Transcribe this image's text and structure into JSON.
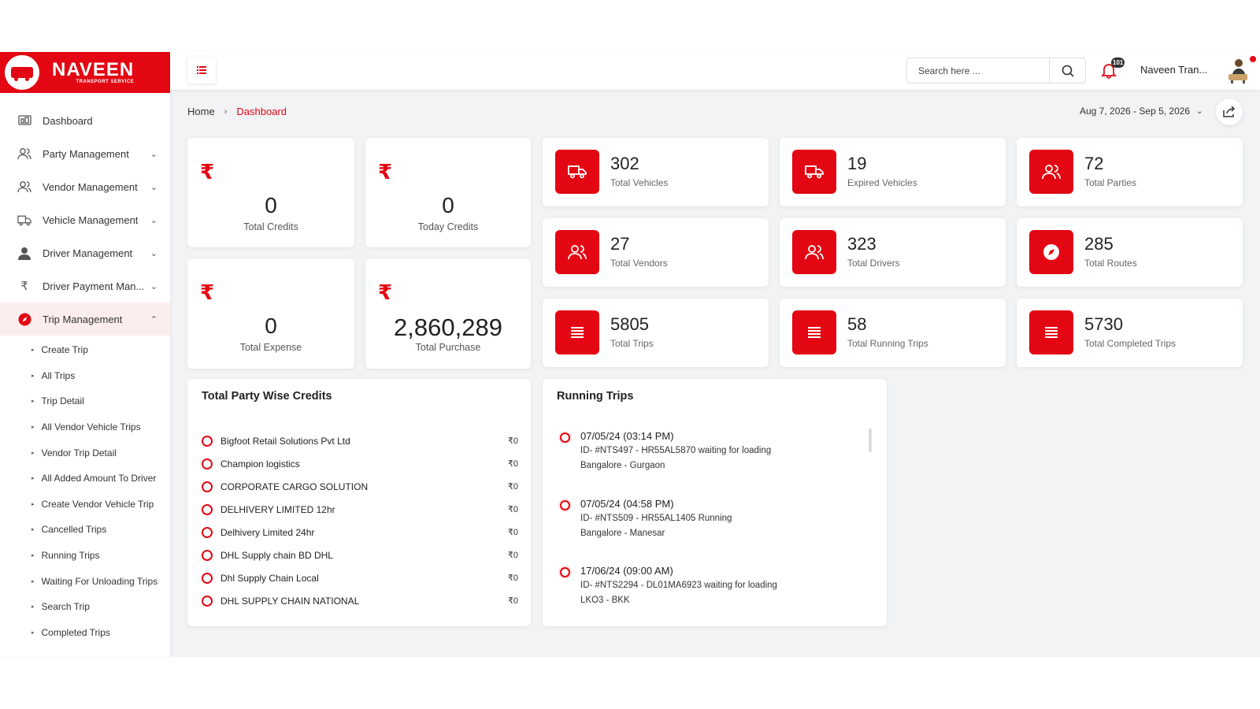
{
  "brand": {
    "name": "NAVEEN",
    "tagline": "TRANSPORT SERVICE",
    "color": "#e30613"
  },
  "topbar": {
    "search_placeholder": "Search here ...",
    "notification_count": "101",
    "user_name": "Naveen Tran..."
  },
  "breadcrumb": {
    "home": "Home",
    "separator": "›",
    "current": "Dashboard"
  },
  "date_range": "Aug 7, 2026 - Sep 5, 2026",
  "sidebar": {
    "items": [
      {
        "label": "Dashboard",
        "icon": "dashboard-icon"
      },
      {
        "label": "Party Management",
        "icon": "users-icon"
      },
      {
        "label": "Vendor Management",
        "icon": "users-icon"
      },
      {
        "label": "Vehicle Management",
        "icon": "truck-icon"
      },
      {
        "label": "Driver Management",
        "icon": "person-icon"
      },
      {
        "label": "Driver Payment Man...",
        "icon": "rupee-icon"
      },
      {
        "label": "Trip Management",
        "icon": "compass-icon"
      }
    ],
    "trip_submenu": [
      "Create Trip",
      "All Trips",
      "Trip Detail",
      "All Vendor Vehicle Trips",
      "Vendor Trip Detail",
      "All Added Amount To Driver",
      "Create Vendor Vehicle Trip",
      "Cancelled Trips",
      "Running Trips",
      "Waiting For Unloading Trips",
      "Search Trip",
      "Completed Trips"
    ]
  },
  "money_cards": [
    {
      "symbol": "₹",
      "value": "0",
      "label": "Total Credits"
    },
    {
      "symbol": "₹",
      "value": "0",
      "label": "Today Credits"
    },
    {
      "symbol": "₹",
      "value": "0",
      "label": "Total Expense"
    },
    {
      "symbol": "₹",
      "value": "2,860,289",
      "label": "Total Purchase"
    }
  ],
  "stats": [
    {
      "value": "302",
      "label": "Total Vehicles",
      "icon": "truck-icon"
    },
    {
      "value": "19",
      "label": "Expired Vehicles",
      "icon": "truck-icon"
    },
    {
      "value": "72",
      "label": "Total Parties",
      "icon": "users-icon"
    },
    {
      "value": "27",
      "label": "Total Vendors",
      "icon": "users-icon"
    },
    {
      "value": "323",
      "label": "Total Drivers",
      "icon": "users-icon"
    },
    {
      "value": "285",
      "label": "Total Routes",
      "icon": "compass-icon"
    },
    {
      "value": "5805",
      "label": "Total Trips",
      "icon": "list-icon"
    },
    {
      "value": "58",
      "label": "Total Running Trips",
      "icon": "list-icon"
    },
    {
      "value": "5730",
      "label": "Total Completed Trips",
      "icon": "list-icon"
    }
  ],
  "party_credits": {
    "title": "Total Party Wise Credits",
    "rows": [
      {
        "name": "Bigfoot Retail Solutions Pvt Ltd",
        "amount": "₹0"
      },
      {
        "name": "Champion logistics",
        "amount": "₹0"
      },
      {
        "name": "CORPORATE CARGO SOLUTION",
        "amount": "₹0"
      },
      {
        "name": "DELHIVERY LIMITED 12hr",
        "amount": "₹0"
      },
      {
        "name": "Delhivery Limited 24hr",
        "amount": "₹0"
      },
      {
        "name": "DHL Supply chain BD DHL",
        "amount": "₹0"
      },
      {
        "name": "Dhl Supply Chain Local",
        "amount": "₹0"
      },
      {
        "name": "DHL SUPPLY CHAIN NATIONAL",
        "amount": "₹0"
      }
    ]
  },
  "running_trips": {
    "title": "Running Trips",
    "trips": [
      {
        "time": "07/05/24 (03:14 PM)",
        "desc": "ID- #NTS497 - HR55AL5870 waiting for loading",
        "route": "Bangalore - Gurgaon"
      },
      {
        "time": "07/05/24 (04:58 PM)",
        "desc": "ID- #NTS509 - HR55AL1405 Running",
        "route": "Bangalore - Manesar"
      },
      {
        "time": "17/06/24 (09:00 AM)",
        "desc": "ID- #NTS2294 - DL01MA6923 waiting for loading",
        "route": "LKO3 - BKK"
      }
    ]
  }
}
